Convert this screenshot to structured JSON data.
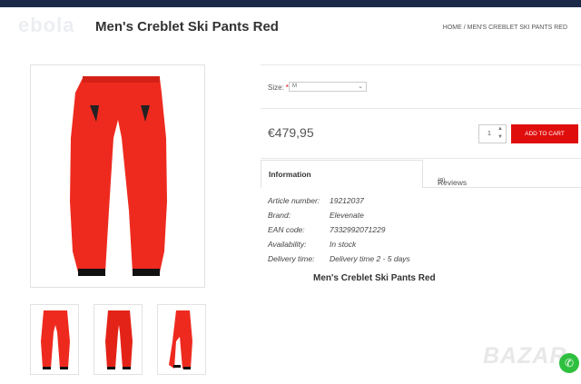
{
  "header": {
    "logo": "ebola",
    "title": "Men's Creblet Ski Pants Red",
    "breadcrumb": "HOME / MEN'S CREBLET SKI PANTS RED"
  },
  "product": {
    "size_label": "Size:",
    "size_required_marker": "*",
    "size_value": "M",
    "price": "€479,95",
    "quantity": "1",
    "add_to_cart": "ADD TO CART"
  },
  "tabs": {
    "information": "Information",
    "reviews": "Reviews",
    "reviews_count": "(0)"
  },
  "specs": [
    {
      "label": "Article number:",
      "value": "19212037"
    },
    {
      "label": "Brand:",
      "value": "Elevenate"
    },
    {
      "label": "EAN code:",
      "value": "7332992071229"
    },
    {
      "label": "Availability:",
      "value": "In stock"
    },
    {
      "label": "Delivery time:",
      "value": "Delivery time 2 - 5 days"
    }
  ],
  "description_title": "Men's Creblet Ski Pants Red",
  "watermark": "BAZAR",
  "colors": {
    "accent": "#e00d0d",
    "pants": "#ee2a1f",
    "topbar": "#1c2a4a"
  },
  "icons": [
    "chevron-down-icon",
    "chevron-up-icon",
    "whatsapp-icon"
  ]
}
